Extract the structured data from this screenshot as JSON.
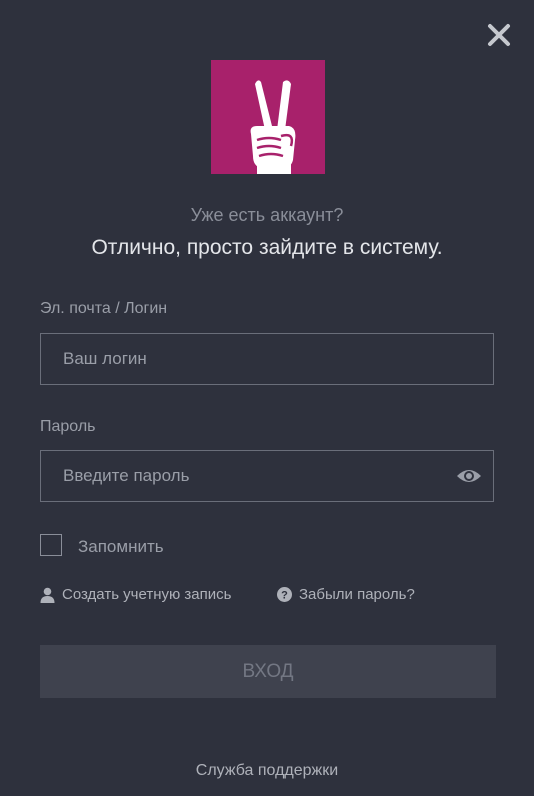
{
  "header": {
    "subtitle": "Уже есть аккаунт?",
    "title": "Отлично, просто зайдите в систему."
  },
  "form": {
    "login_label": "Эл. почта / Логин",
    "login_placeholder": "Ваш логин",
    "password_label": "Пароль",
    "password_placeholder": "Введите пароль",
    "remember_label": "Запомнить",
    "submit_label": "ВХОД"
  },
  "links": {
    "create_account": "Создать учетную запись",
    "forgot_password": "Забыли пароль?",
    "support": "Служба поддержки"
  },
  "colors": {
    "background": "#2e313d",
    "logo_background": "#a8216b",
    "button_background": "#3f424e"
  },
  "icons": {
    "close": "close-icon",
    "logo": "victory-hand-icon",
    "password_toggle": "eye-icon",
    "user": "user-icon",
    "help": "question-circle-icon"
  }
}
